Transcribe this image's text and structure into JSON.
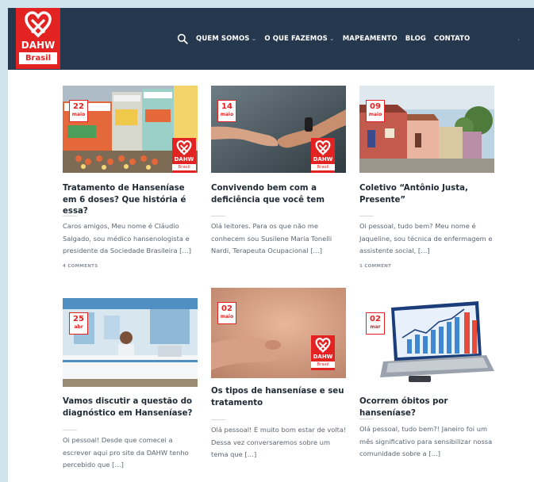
{
  "logo": {
    "word": "DAHW",
    "sub": "Brasil"
  },
  "nav": {
    "items": [
      {
        "label": "QUEM SOMOS",
        "caret": "⌄"
      },
      {
        "label": "O QUE FAZEMOS",
        "caret": "⌄"
      },
      {
        "label": "MAPEAMENTO",
        "caret": ""
      },
      {
        "label": "BLOG",
        "caret": ""
      },
      {
        "label": "CONTATO",
        "caret": ""
      }
    ],
    "dot": "·"
  },
  "posts": [
    {
      "day": "22",
      "month": "maio",
      "title": "Tratamento de Hanseníase em 6 doses? Que história é essa?",
      "excerpt": "Caros amigos, Meu nome é Cláudio Salgado, sou médico hansenologista e presidente da Sociedade Brasileira […]",
      "comments": "4 COMMENTS",
      "brand_word": "DAHW",
      "brand_sub": "Brasil"
    },
    {
      "day": "14",
      "month": "maio",
      "title": "Convivendo bem com a deficiência que você tem",
      "excerpt": "Olá leitores. Para os que não me conhecem sou Susilene Maria Tonelli Nardi, Terapeuta Ocupacional […]",
      "comments": "",
      "brand_word": "DAHW",
      "brand_sub": "Brasil"
    },
    {
      "day": "09",
      "month": "maio",
      "title": "Coletivo “Antônio Justa, Presente”",
      "excerpt": "Oi pessoal, tudo bem? Meu nome é Jaqueline, sou técnica de enfermagem e assistente social, […]",
      "comments": "1 COMMENT"
    },
    {
      "day": "25",
      "month": "abr",
      "title": "Vamos discutir a questão do diagnóstico em Hanseníase?",
      "excerpt": "Oi pessoal! Desde que comecei a escrever aqui pro site da DAHW tenho percebido que […]"
    },
    {
      "day": "02",
      "month": "maio",
      "title": "Os tipos de hanseníase e seu tratamento",
      "excerpt": "Olá pessoal! É muito bom estar de volta! Dessa vez conversaremos sobre um tema que […]",
      "brand_word": "DAHW",
      "brand_sub": "Brasil"
    },
    {
      "day": "02",
      "month": "mar",
      "title": "Ocorrem óbitos por hanseníase?",
      "excerpt": "Olá pessoal, tudo bem?! Janeiro foi um mês significativo para sensibilizar nossa comunidade sobre a […]"
    }
  ],
  "colors": {
    "header": "#25384e",
    "brand_red": "#e32222",
    "background": "#cfe3ec"
  },
  "icons": {
    "search": "search-icon",
    "logo": "heart-ribbon-icon"
  }
}
